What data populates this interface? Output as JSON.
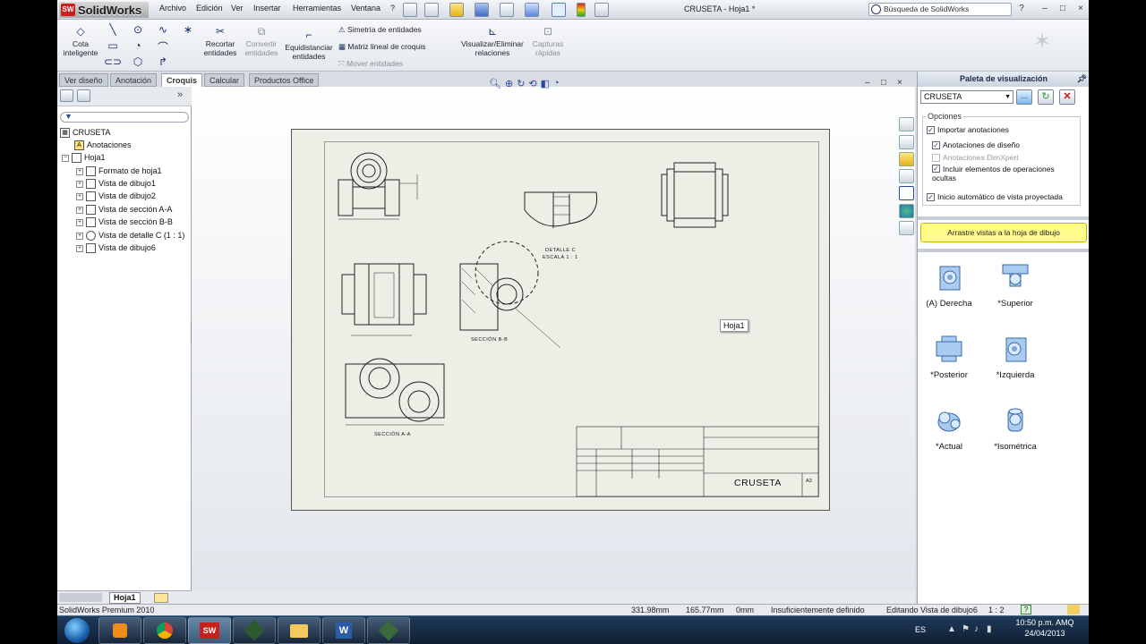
{
  "app": {
    "brand": "SolidWorks",
    "window_title": "CRUSETA - Hoja1 *"
  },
  "menu": [
    "Archivo",
    "Edición",
    "Ver",
    "Insertar",
    "Herramientas",
    "Ventana",
    "?"
  ],
  "search": {
    "placeholder": "Búsqueda de SolidWorks"
  },
  "window_controls": [
    "?",
    "–",
    "□",
    "×"
  ],
  "command_manager": {
    "smart_dimension": "Cota inteligente",
    "trim": "Recortar entidades",
    "convert": "Convertir entidades",
    "offset": "Equidistanciar entidades",
    "mirror": "Simetría de entidades",
    "linear_pattern": "Matriz lineal de croquis",
    "move": "Mover entidades",
    "relations": "Visualizar/Eliminar relaciones",
    "snaps": "Capturas rápidas"
  },
  "tabs": [
    {
      "label": "Ver diseño",
      "active": false
    },
    {
      "label": "Anotación",
      "active": false
    },
    {
      "label": "Croquis",
      "active": true
    },
    {
      "label": "Calcular",
      "active": false
    },
    {
      "label": "Productos Office",
      "active": false
    }
  ],
  "tree": {
    "root": "CRUSETA",
    "annotations": "Anotaciones",
    "sheet": "Hoja1",
    "items": [
      "Formato de hoja1",
      "Vista de dibujo1",
      "Vista de dibujo2",
      "Vista de sección A-A",
      "Vista de sección B-B",
      "Vista de detalle C (1 : 1)",
      "Vista de dibujo6"
    ]
  },
  "sheet_tab": "Hoja1",
  "drawing": {
    "detail_label": "DETALLE C",
    "detail_scale": "ESCALA 1 : 1",
    "section_bb": "SECCIÓN B-B",
    "section_aa": "SECCIÓN A-A",
    "sheet_tooltip": "Hoja1",
    "title_block_name": "CRUSETA",
    "sheet_size": "A3"
  },
  "palette": {
    "title": "Paleta de visualización",
    "document": "CRUSETA",
    "options_label": "Opciones",
    "options": [
      {
        "label": "Importar anotaciones",
        "checked": true,
        "enabled": true
      },
      {
        "label": "Anotaciones de diseño",
        "checked": true,
        "enabled": true
      },
      {
        "label": "Anotaciones DimXpert",
        "checked": false,
        "enabled": false
      },
      {
        "label": "Incluir elementos de operaciones ocultas",
        "checked": true,
        "enabled": true
      },
      {
        "label": "Inicio automático de vista proyectada",
        "checked": true,
        "enabled": true
      }
    ],
    "drag_hint": "Arrastre vistas a la hoja de dibujo",
    "views": [
      "(A) Derecha",
      "*Superior",
      "*Posterior",
      "*Izquierda",
      "*Actual",
      "*Isométrica"
    ]
  },
  "status": {
    "product": "SolidWorks Premium 2010",
    "x": "331.98mm",
    "y": "165.77mm",
    "z": "0mm",
    "definition": "Insuficientemente definido",
    "editing": "Editando Vista de dibujo6",
    "scale": "1 : 2",
    "help": "?"
  },
  "taskbar": {
    "lang": "ES",
    "time": "10:50 p.m. AMQ",
    "date": "24/04/2013"
  },
  "colors": {
    "accent": "#1c3a7a",
    "highlight": "#fffb8a",
    "sheet": "#efeee6"
  }
}
